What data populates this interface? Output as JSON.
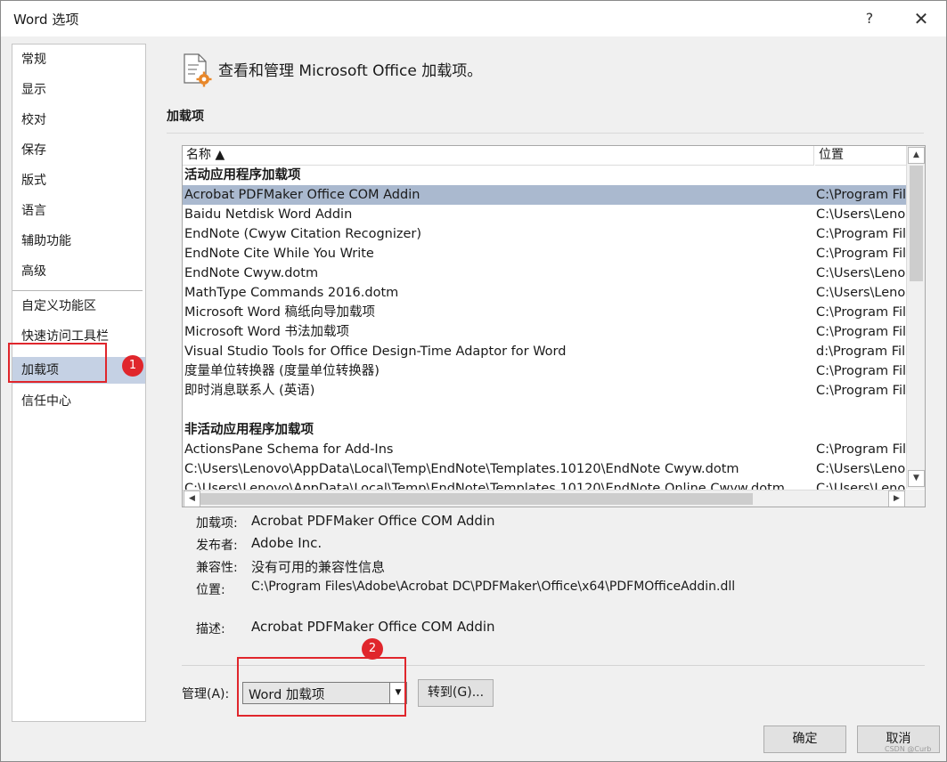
{
  "window": {
    "title": "Word 选项",
    "help_glyph": "?",
    "close_glyph": "✕"
  },
  "nav": {
    "items": [
      {
        "label": "常规"
      },
      {
        "label": "显示"
      },
      {
        "label": "校对"
      },
      {
        "label": "保存"
      },
      {
        "label": "版式"
      },
      {
        "label": "语言"
      },
      {
        "label": "辅助功能"
      },
      {
        "label": "高级"
      },
      {
        "label": "自定义功能区"
      },
      {
        "label": "快速访问工具栏"
      },
      {
        "label": "加载项"
      },
      {
        "label": "信任中心"
      }
    ],
    "active": "加载项"
  },
  "annotations": {
    "badge1": "1",
    "badge2": "2",
    "accent_color": "#e0262c"
  },
  "header": {
    "heading": "查看和管理 Microsoft Office 加载项。",
    "icon": "addin-settings-icon"
  },
  "section": {
    "title": "加载项"
  },
  "list": {
    "columns": {
      "name": "名称 ▲",
      "location": "位置"
    },
    "groups": [
      {
        "title": "活动应用程序加载项",
        "rows": [
          {
            "name": "Acrobat PDFMaker Office COM Addin",
            "location": "C:\\Program Fil"
          },
          {
            "name": "Baidu Netdisk Word Addin",
            "location": "C:\\Users\\Leno"
          },
          {
            "name": "EndNote (Cwyw Citation Recognizer)",
            "location": "C:\\Program Fil"
          },
          {
            "name": "EndNote Cite While You Write",
            "location": "C:\\Program Fil"
          },
          {
            "name": "EndNote Cwyw.dotm",
            "location": "C:\\Users\\Leno"
          },
          {
            "name": "MathType Commands 2016.dotm",
            "location": "C:\\Users\\Leno"
          },
          {
            "name": "Microsoft Word 稿纸向导加载项",
            "location": "C:\\Program Fil"
          },
          {
            "name": "Microsoft Word 书法加载项",
            "location": "C:\\Program Fil"
          },
          {
            "name": "Visual Studio Tools for Office Design-Time Adaptor for Word",
            "location": "d:\\Program Fil"
          },
          {
            "name": "度量单位转换器 (度量单位转换器)",
            "location": "C:\\Program Fil"
          },
          {
            "name": "即时消息联系人 (英语)",
            "location": "C:\\Program Fil"
          }
        ]
      },
      {
        "title": "非活动应用程序加载项",
        "rows": [
          {
            "name": "ActionsPane Schema for Add-Ins",
            "location": "C:\\Program Fil"
          },
          {
            "name": "C:\\Users\\Lenovo\\AppData\\Local\\Temp\\EndNote\\Templates.10120\\EndNote Cwyw.dotm",
            "location": "C:\\Users\\Leno"
          },
          {
            "name": "C:\\Users\\Lenovo\\AppData\\Local\\Temp\\EndNote\\Templates.10120\\EndNote Online Cwyw.dotm",
            "location": "C:\\Users\\Leno"
          }
        ]
      }
    ],
    "selected": "Acrobat PDFMaker Office COM Addin"
  },
  "details": {
    "addin_label": "加载项:",
    "addin_value": "Acrobat PDFMaker Office COM Addin",
    "publisher_label": "发布者:",
    "publisher_value": "Adobe Inc.",
    "compat_label": "兼容性:",
    "compat_value": "没有可用的兼容性信息",
    "location_label": "位置:",
    "location_value": "C:\\Program Files\\Adobe\\Acrobat DC\\PDFMaker\\Office\\x64\\PDFMOfficeAddin.dll",
    "desc_label": "描述:",
    "desc_value": "Acrobat PDFMaker Office COM Addin"
  },
  "manage": {
    "label": "管理(A):",
    "selected": "Word 加载项",
    "goto_label": "转到(G)..."
  },
  "footer": {
    "ok_label": "确定",
    "cancel_label": "取消",
    "watermark": "CSDN @Curb"
  }
}
